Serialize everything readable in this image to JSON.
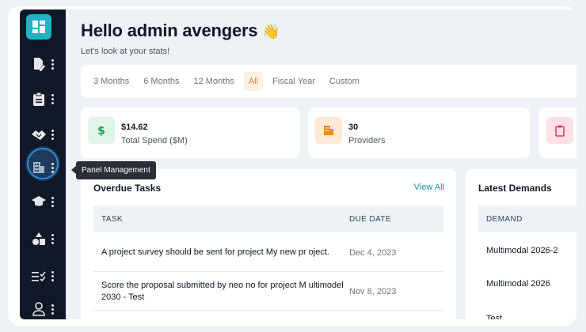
{
  "header": {
    "greeting": "Hello admin avengers",
    "wave_emoji": "👋",
    "subtitle": "Let's look at your stats!"
  },
  "range_tabs": [
    {
      "label": "3 Months",
      "active": false
    },
    {
      "label": "6 Months",
      "active": false
    },
    {
      "label": "12 Months",
      "active": false
    },
    {
      "label": "All",
      "active": true
    },
    {
      "label": "Fiscal Year",
      "active": false
    },
    {
      "label": "Custom",
      "active": false
    }
  ],
  "stats": [
    {
      "value": "$14.62",
      "label": "Total Spend ($M)",
      "icon": "dollar-icon",
      "color": "#14a05a"
    },
    {
      "value": "30",
      "label": "Providers",
      "icon": "building-icon",
      "color": "#f08a24"
    },
    {
      "value": "",
      "label": "",
      "icon": "clipboard-icon",
      "color": "#e23a5a"
    }
  ],
  "sidebar": {
    "tooltip": "Panel Management",
    "items": [
      {
        "icon": "edit-document-icon"
      },
      {
        "icon": "clipboard-icon"
      },
      {
        "icon": "handshake-icon"
      },
      {
        "icon": "building-icon"
      },
      {
        "icon": "graduation-cap-icon"
      },
      {
        "icon": "shapes-icon"
      },
      {
        "icon": "checklist-icon"
      },
      {
        "icon": "user-icon"
      }
    ]
  },
  "overdue": {
    "title": "Overdue Tasks",
    "view_all": "View All",
    "col_task": "TASK",
    "col_due": "DUE DATE",
    "rows": [
      {
        "task": "A project survey should be sent for project My new pr oject.",
        "due": "Dec 4, 2023"
      },
      {
        "task": "Score the proposal submitted by neo no for project M ultimodel 2030 - Test",
        "due": "Nov 8, 2023"
      }
    ]
  },
  "demands": {
    "title": "Latest Demands",
    "col_demand": "DEMAND",
    "rows": [
      "Multimodal 2026-2",
      "Multimodal 2026",
      "Test"
    ]
  },
  "colors": {
    "sidebar_bg": "#111827",
    "accent_teal": "#1fb3c4",
    "active_tab": "#f08a24",
    "link": "#1f8fa8"
  }
}
